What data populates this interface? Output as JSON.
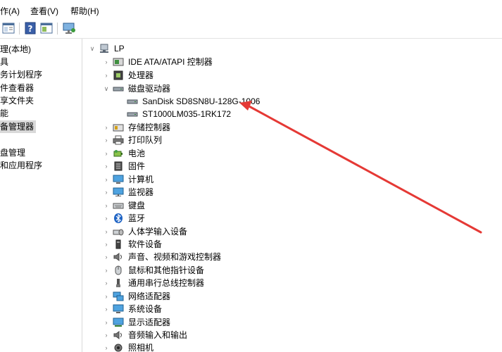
{
  "menu": {
    "action": "作(A)",
    "view": "查看(V)",
    "help": "帮助(H)"
  },
  "toolbar_icons": [
    "properties-icon",
    "help-icon",
    "view-pane-icon",
    "monitor-icon"
  ],
  "left_pane": {
    "items": [
      {
        "label": "理(本地)"
      },
      {
        "label": "具"
      },
      {
        "label": "务计划程序"
      },
      {
        "label": "件查看器"
      },
      {
        "label": "享文件夹"
      },
      {
        "label": "能"
      },
      {
        "label": "备管理器",
        "selected": true
      },
      {
        "label": ""
      },
      {
        "label": "盘管理"
      },
      {
        "label": "和应用程序"
      }
    ]
  },
  "tree": {
    "root": "LP",
    "nodes": [
      {
        "label": "IDE ATA/ATAPI 控制器",
        "expander": "collapsed",
        "icon": "ide-controller-icon"
      },
      {
        "label": "处理器",
        "expander": "collapsed",
        "icon": "processor-icon"
      },
      {
        "label": "磁盘驱动器",
        "expander": "expanded",
        "icon": "disk-drive-icon",
        "children": [
          {
            "label": "SanDisk SD8SN8U-128G-1006",
            "icon": "disk-drive-icon"
          },
          {
            "label": "ST1000LM035-1RK172",
            "icon": "disk-drive-icon"
          }
        ]
      },
      {
        "label": "存储控制器",
        "expander": "collapsed",
        "icon": "storage-controller-icon"
      },
      {
        "label": "打印队列",
        "expander": "collapsed",
        "icon": "printer-icon"
      },
      {
        "label": "电池",
        "expander": "collapsed",
        "icon": "battery-icon"
      },
      {
        "label": "固件",
        "expander": "collapsed",
        "icon": "firmware-icon"
      },
      {
        "label": "计算机",
        "expander": "collapsed",
        "icon": "computer-icon"
      },
      {
        "label": "监视器",
        "expander": "collapsed",
        "icon": "monitor-icon"
      },
      {
        "label": "键盘",
        "expander": "collapsed",
        "icon": "keyboard-icon"
      },
      {
        "label": "蓝牙",
        "expander": "collapsed",
        "icon": "bluetooth-icon"
      },
      {
        "label": "人体学输入设备",
        "expander": "collapsed",
        "icon": "hid-icon"
      },
      {
        "label": "软件设备",
        "expander": "collapsed",
        "icon": "software-device-icon"
      },
      {
        "label": "声音、视频和游戏控制器",
        "expander": "collapsed",
        "icon": "sound-icon"
      },
      {
        "label": "鼠标和其他指针设备",
        "expander": "collapsed",
        "icon": "mouse-icon"
      },
      {
        "label": "通用串行总线控制器",
        "expander": "collapsed",
        "icon": "usb-icon"
      },
      {
        "label": "网络适配器",
        "expander": "collapsed",
        "icon": "network-adapter-icon"
      },
      {
        "label": "系统设备",
        "expander": "collapsed",
        "icon": "system-device-icon"
      },
      {
        "label": "显示适配器",
        "expander": "collapsed",
        "icon": "display-adapter-icon"
      },
      {
        "label": "音频输入和输出",
        "expander": "collapsed",
        "icon": "audio-io-icon"
      },
      {
        "label": "照相机",
        "expander": "collapsed",
        "icon": "camera-icon"
      }
    ]
  },
  "annotation": {
    "color": "#e53935"
  }
}
